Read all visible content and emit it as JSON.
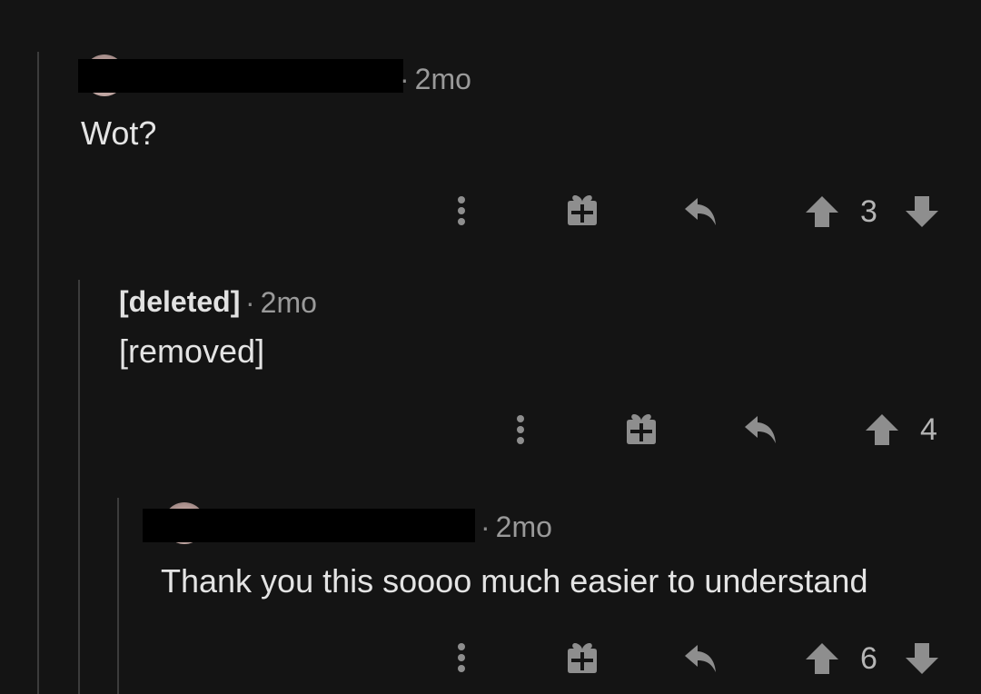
{
  "comments": [
    {
      "author": "",
      "time": "2mo",
      "body": "Wot?",
      "score": "3",
      "show_downvote": true
    },
    {
      "author": "[deleted]",
      "time": "2mo",
      "body": "[removed]",
      "score": "4",
      "show_downvote": false
    },
    {
      "author": "",
      "time": "2mo",
      "body": "Thank you this soooo much easier to understand",
      "score": "6",
      "show_downvote": true
    }
  ],
  "icons": {
    "more": "vertical-ellipsis",
    "award": "gift",
    "reply": "reply-arrow",
    "upvote": "arrow-up",
    "downvote": "arrow-down"
  },
  "colors": {
    "background": "#141414",
    "thread_line": "#3c3c3c",
    "icon": "#8e8e8e",
    "text": "#e4e4e4",
    "meta": "#9a9a9a",
    "redaction": "#000000",
    "avatar_badge": "#1f8de0"
  }
}
